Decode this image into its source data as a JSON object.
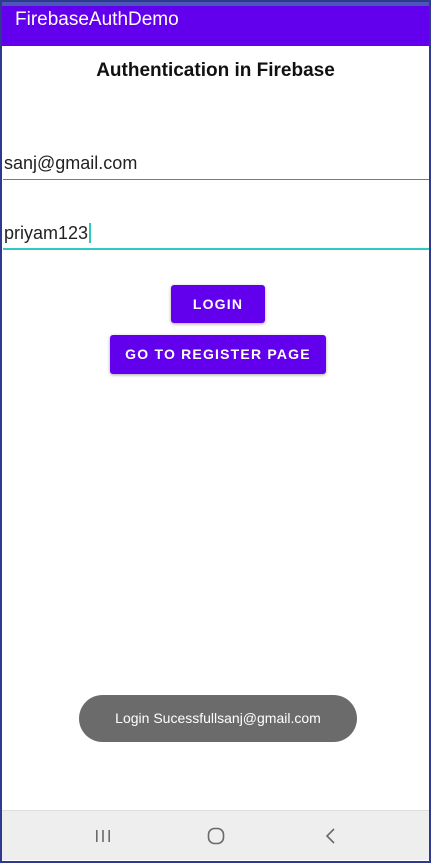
{
  "app_bar": {
    "title": "FirebaseAuthDemo",
    "color": "#6200ee"
  },
  "page": {
    "heading": "Authentication in Firebase"
  },
  "form": {
    "email_value": "sanj@gmail.com",
    "password_value": "priyam123"
  },
  "buttons": {
    "login_label": "LOGIN",
    "register_label": "GO TO REGISTER PAGE",
    "color": "#6200ee"
  },
  "toast": {
    "message": "Login Sucessfullsanj@gmail.com"
  },
  "nav_bar": {
    "recents_icon": "recents-icon",
    "home_icon": "home-icon",
    "back_icon": "back-icon"
  }
}
